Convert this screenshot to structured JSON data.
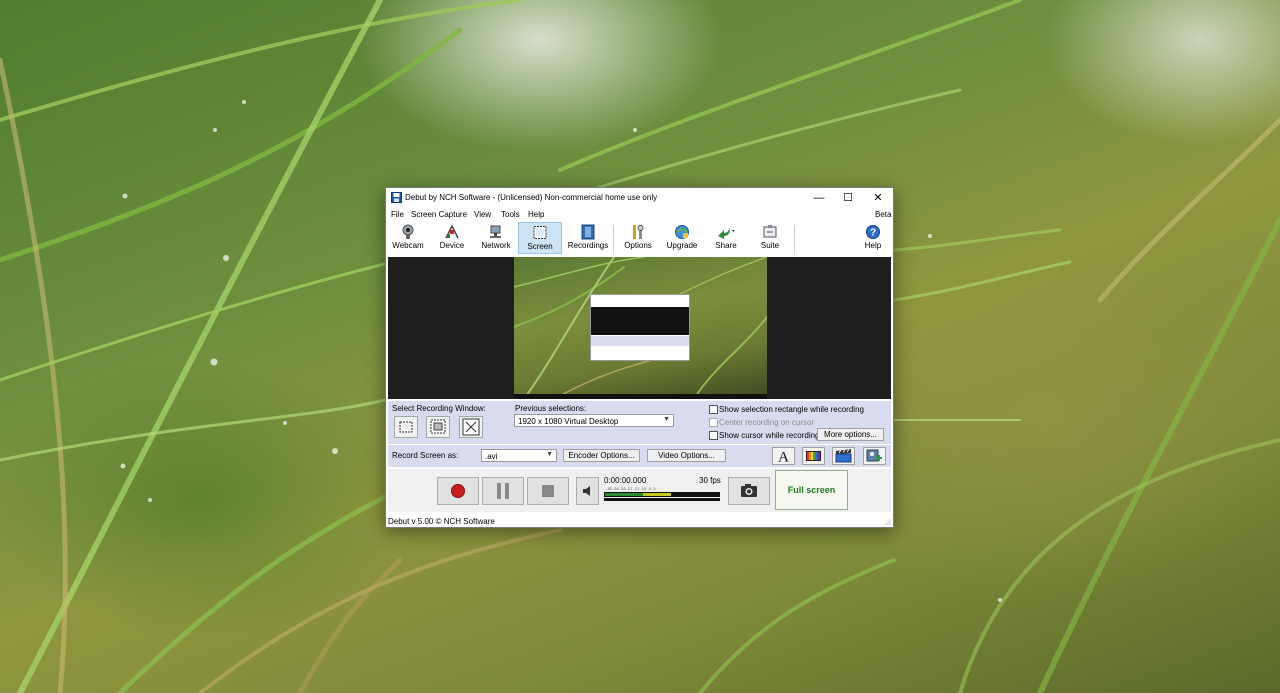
{
  "window": {
    "title": "Debut by NCH Software - (Unlicensed) Non-commercial home use only",
    "minimize_glyph": "—",
    "maximize_glyph": "☐",
    "close_glyph": "✕"
  },
  "menu": {
    "items": [
      "File",
      "Screen Capture",
      "View",
      "Tools",
      "Help"
    ],
    "beta": "Beta"
  },
  "toolbar": {
    "webcam": "Webcam",
    "device": "Device",
    "network": "Network",
    "screen": "Screen",
    "recordings": "Recordings",
    "options": "Options",
    "upgrade": "Upgrade",
    "share": "Share",
    "suite": "Suite",
    "help": "Help",
    "selected": "Screen"
  },
  "capture_options": {
    "select_window_label": "Select Recording Window:",
    "previous_selections_label": "Previous selections:",
    "previous_selection_value": "1920 x 1080 Virtual Desktop",
    "show_selection_rect": "Show selection rectangle while recording",
    "center_on_cursor": "Center recording on cursor",
    "show_cursor": "Show cursor while recording",
    "more_options": "More options..."
  },
  "encoder": {
    "record_as_label": "Record Screen as:",
    "format_value": ".avi",
    "encoder_options": "Encoder Options...",
    "video_options": "Video Options..."
  },
  "controls": {
    "time": "0:00:00.000",
    "fps": "30 fps",
    "full_screen": "Full screen"
  },
  "status": {
    "text": "Debut v 5.00 © NCH Software"
  },
  "colors": {
    "panel_bg": "#d9dcef",
    "selected_tab": "#cde4f7",
    "record_red": "#c81e1e",
    "full_screen_green": "#1f7a1f"
  }
}
